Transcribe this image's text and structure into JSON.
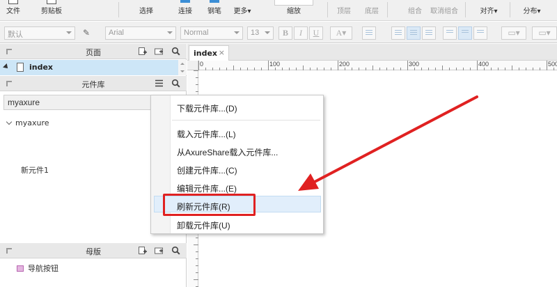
{
  "toolbar": {
    "file_label": "文件",
    "clipboard_label": "剪贴板",
    "select_label": "选择",
    "connect_label": "连接",
    "pen_label": "钢笔",
    "more_label": "更多▾",
    "zoom_label": "缩放",
    "top_label": "顶层",
    "bottom_label": "底层",
    "group_label": "组合",
    "ungroup_label": "取消组合",
    "align_label": "对齐▾",
    "distribute_label": "分布▾"
  },
  "format": {
    "style_value": "默认",
    "font_value": "Arial",
    "weight_value": "Normal",
    "size_value": "13"
  },
  "pages_panel": {
    "title": "页面",
    "page_name": "index"
  },
  "library_panel": {
    "title": "元件库",
    "selected_library": "myaxure",
    "tree_root": "myaxure",
    "widget_name": "新元件1"
  },
  "masters_panel": {
    "title": "母版",
    "item_name": "导航按钮"
  },
  "canvas": {
    "tab_label": "index",
    "tab_close": "×",
    "ruler_labels": [
      "0",
      "100",
      "200",
      "300",
      "400",
      "500"
    ]
  },
  "context_menu": {
    "items": [
      "下载元件库...(D)",
      "载入元件库...(L)",
      "从AxureShare载入元件库...",
      "创建元件库...(C)",
      "编辑元件库...(E)",
      "刷新元件库(R)",
      "卸载元件库(U)"
    ]
  },
  "annotation_colors": {
    "highlight_box": "#e02121",
    "arrow": "#e02121"
  }
}
